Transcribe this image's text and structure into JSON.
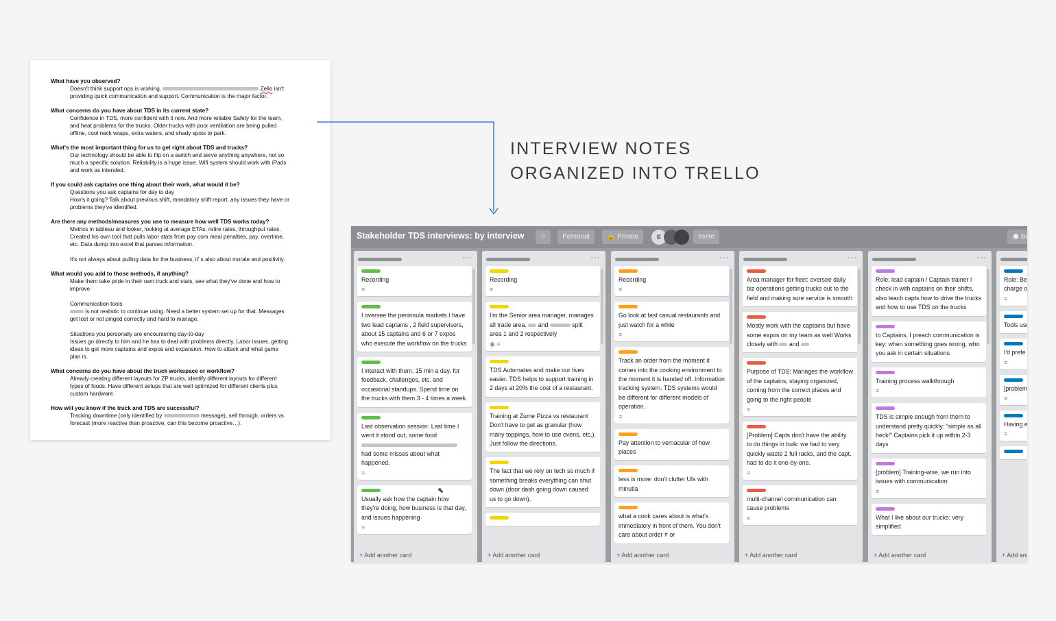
{
  "headline": {
    "line1": "INTERVIEW NOTES",
    "line2": "ORGANIZED INTO TRELLO"
  },
  "document": {
    "qa": [
      {
        "q": "What have you observed?",
        "a": [
          "Doesn't think support ops is working. {R140} Zello isn't",
          "providing quick communication and support. Communication is the major factor."
        ]
      },
      {
        "q": "What concerns do you have about TDS in its current state?",
        "a": [
          "Confidence in TDS, more confident with it now. And more reliable Safety for the team,",
          "and heat problems for the trucks. Older trucks with poor ventilation are being pulled",
          "offline, cool neck wraps, extra waters, and shady spots to park."
        ]
      },
      {
        "q": "What's the most important thing for us to get right about TDS and trucks?",
        "a": [
          "Our technology should be able to flip on a switch and serve anything anywhere, not so",
          "much a specific solution. Reliability is a huge issue. Wifi system should work with iPads",
          "and work as intended."
        ]
      },
      {
        "q": "If you could ask captains one thing about their work, what would it be?",
        "a": [
          "Questions you ask captains for day to day",
          "How's it going? Talk about previous shift, mandatory shift report, any issues they have or",
          "problems they've identified."
        ]
      },
      {
        "q": "Are there any methods/measures you use to measure how well TDS works today?",
        "a": [
          "Metrics in tableau and looker, looking at average ETAs, retire rates, throughput rates.",
          "Created his own tool that pulls labor stats from pay com meal penalties, pay, overtime,",
          "etc. Data dump into excel that parses information.",
          "",
          "It's not always about pulling data for the business, it' s also about morale and positivity."
        ]
      },
      {
        "q": "What would you add to those methods, if anything?",
        "a": [
          "Make them take pride in their own truck and stats, see what they've done and how to",
          "improve",
          "",
          "Communication tools",
          "{R20} is not realistic to continue using. Need a better system set up for that. Messages",
          "get lost or not pinged correctly and hard to manage.",
          "",
          "Situations you personally are encountering day-to-day",
          "Issues go directly to him and he has to deal with problems directly. Labor issues, getting",
          "ideas to get more captains and expos and expansion. How to attack and what game",
          "plan is."
        ]
      },
      {
        "q": "What concerns do you have about the truck workspace or workflow?",
        "a": [
          "Already creating different layouts for ZP trucks, identify different layouts for different",
          "types of foods. Have different setups that are well optimized for different clients plus",
          "custom hardware."
        ]
      },
      {
        "q": "How will you know if the truck and TDS are successful?",
        "a": [
          "Tracking downtime (only identified by {R52} message), sell through, orders vs",
          "forecast (more reactive than proactive, can this become proactive…)."
        ]
      }
    ]
  },
  "board": {
    "title": "Stakeholder TDS interviews: by interview",
    "buttons": {
      "star": "☆",
      "personal": "Personal",
      "private": "🔒 Private",
      "avatar_initial": "E",
      "invite": "Invite",
      "board_menu": "☗ Bo"
    },
    "add_card": "+ Add another card",
    "colors": {
      "green": "#61bd4f",
      "yellow": "#f2d600",
      "orange": "#ff9f1a",
      "red": "#eb5a46",
      "purple": "#c377e0",
      "blue": "#0079bf"
    },
    "lists": [
      {
        "cards": [
          {
            "label": "green",
            "text": "Recording",
            "badges": "≡"
          },
          {
            "label": "green",
            "text": "I oversee the peninsula markets I have two lead captains , 2 field supervisors, about 15 captains and 6 or 7 expos who execute the workflow on the trucks",
            "badges": ""
          },
          {
            "label": "green",
            "text": "I interact with them, 15 min a day, for feedback, challenges, etc. and occasional standups. Spend time on the trucks with them 3 - 4 times a week.",
            "badges": ""
          },
          {
            "label": "green",
            "text": "Last observation session: Last time I went it stood out, some food {R140} had some misses about what happened.",
            "badges": "≡"
          },
          {
            "label": "green",
            "text": "Usually ask how the captain how they're doing, how business is that day, and issues happening",
            "badges": "≡"
          }
        ]
      },
      {
        "cards": [
          {
            "label": "yellow",
            "text": "Recording",
            "badges": "≡"
          },
          {
            "label": "yellow",
            "text": "I'm the Senior area manager, manages all trade area. {R12} and {R30} split area 1 and 2 respectively",
            "badges": "◉ ≡"
          },
          {
            "label": "yellow",
            "text": "TDS Automates and make our lives easier. TDS helps to support training in 2 days at 20% the cost of a restaurant.",
            "badges": ""
          },
          {
            "label": "yellow",
            "text": "Training at Zume Pizza vs restaurant Don't have to get as granular (how many toppings, how to use ovens, etc.). Just follow the directions.",
            "badges": ""
          },
          {
            "label": "yellow",
            "text": "The fact that we rely on tech so much if something breaks everything can shut down (door dash going down caused us to go down).",
            "badges": ""
          },
          {
            "label": "yellow",
            "text": "",
            "badges": ""
          }
        ]
      },
      {
        "cards": [
          {
            "label": "orange",
            "text": "Recording",
            "badges": "≡"
          },
          {
            "label": "orange",
            "text": "Go look at fast casual restaurants and just watch for a while",
            "badges": "≡"
          },
          {
            "label": "orange",
            "text": "Track an order from the moment it comes into the cooking environment to the moment it is handed off. Information tracking system. TDS systems would be different for different models of operation.",
            "badges": "≡"
          },
          {
            "label": "orange",
            "text": "Pay attention to vernacular of how places",
            "badges": ""
          },
          {
            "label": "orange",
            "text": "less is more: don't clutter UIs with minutia",
            "badges": ""
          },
          {
            "label": "orange",
            "text": "what a cook cares about is what's immediately in front of them. You don't care about order # or",
            "badges": ""
          }
        ]
      },
      {
        "cards": [
          {
            "label": "red",
            "text": "Area manager for fleet: oversee daily biz operations getting trucks out to the field and making sure service is smooth",
            "badges": ""
          },
          {
            "label": "red",
            "text": "Mostly work with the captains but have some expos on my team as well Works closely with {R12} and {R12}",
            "badges": ""
          },
          {
            "label": "red",
            "text": "Purpose of TDS: Manages the workflow of the captains, staying organized, coming from the correct places and going to the right people",
            "badges": "≡"
          },
          {
            "label": "red",
            "text": "[Problem] Capts don't have the ability to do things in bulk: we had to very quickly waste 2 full racks, and the capt. had to do it one-by-one.",
            "badges": "≡"
          },
          {
            "label": "red",
            "text": "multi-channel communication can cause problems",
            "badges": "≡"
          }
        ]
      },
      {
        "cards": [
          {
            "label": "purple",
            "text": "Role: lead captain / Captain trainer I check in with captains on their shifts, also teach capts how to drive the trucks and how to use TDS on the trucks",
            "badges": ""
          },
          {
            "label": "purple",
            "text": "to Captains, I preach communication is key: when something goes wrong, who you ask in certain situations",
            "badges": ""
          },
          {
            "label": "purple",
            "text": "Training process walkthrough",
            "badges": "≡"
          },
          {
            "label": "purple",
            "text": "TDS is simple enough from them to understand pretty quickly: “simple as all heck!” Captains pick it up within 2-3 days",
            "badges": ""
          },
          {
            "label": "purple",
            "text": "[problem] Training-wise, we run into issues with communication",
            "badges": "≡"
          },
          {
            "label": "purple",
            "text": "What I like about our trucks: very simplified",
            "badges": ""
          }
        ]
      },
      {
        "cards": [
          {
            "label": "blue",
            "text": "Role: Be months a fleet tea manager charge o",
            "badges": "≡"
          },
          {
            "label": "blue",
            "text": "Tools use lead cap",
            "badges": ""
          },
          {
            "label": "blue",
            "text": "I'd prefe be traine would be",
            "badges": "≡"
          },
          {
            "label": "blue",
            "text": "[problem can take assigned",
            "badges": "≡"
          },
          {
            "label": "blue",
            "text": "Having e helpful: together",
            "badges": "≡"
          },
          {
            "label": "blue",
            "text": "",
            "badges": ""
          }
        ]
      }
    ]
  }
}
